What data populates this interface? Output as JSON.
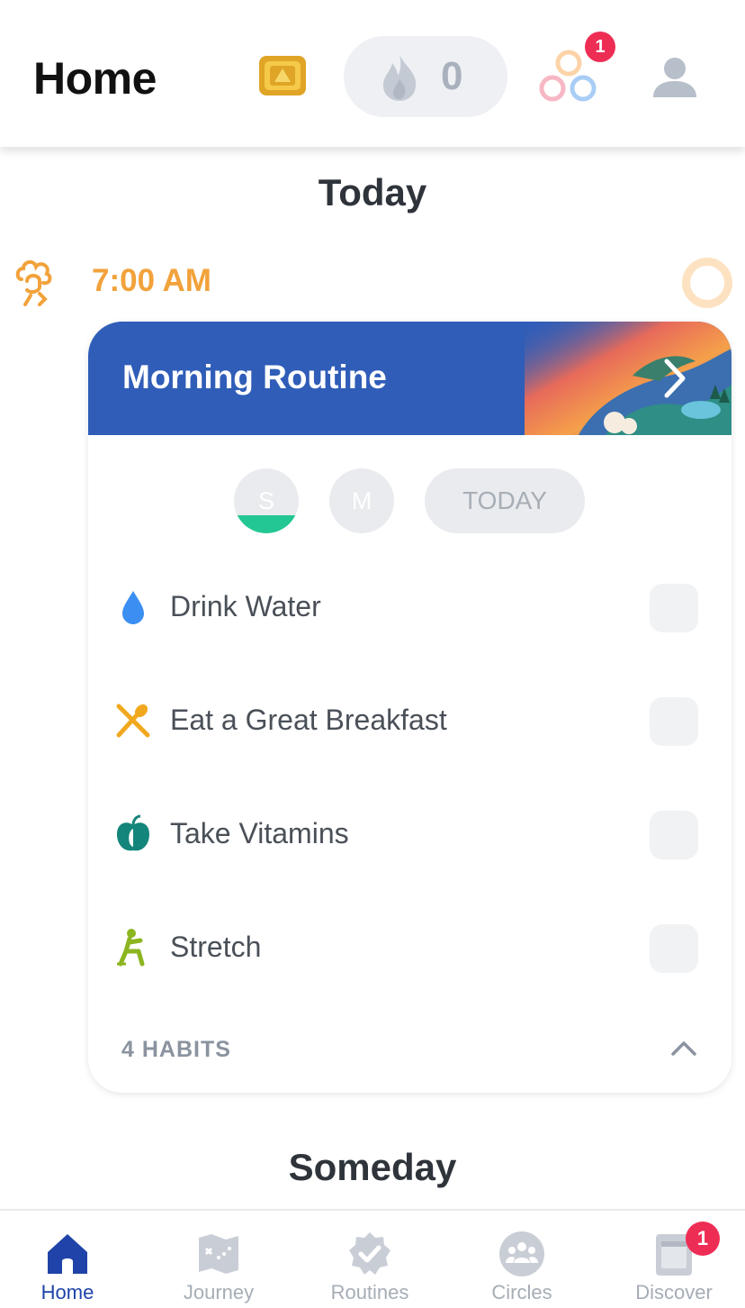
{
  "header": {
    "title": "Home",
    "streak_count": "0",
    "circles_badge": "1"
  },
  "today": {
    "section_title": "Today",
    "time": "7:00 AM",
    "routine": {
      "title": "Morning Routine",
      "days": [
        "S",
        "M",
        "TODAY"
      ],
      "habits": [
        {
          "label": "Drink Water",
          "icon": "water-drop-icon",
          "color": "#3b8ff2"
        },
        {
          "label": "Eat a Great Breakfast",
          "icon": "spoon-fork-icon",
          "color": "#f2a81e"
        },
        {
          "label": "Take Vitamins",
          "icon": "apple-icon",
          "color": "#14857a"
        },
        {
          "label": "Stretch",
          "icon": "stretch-icon",
          "color": "#8cb51f"
        }
      ],
      "habit_count": "4 HABITS"
    }
  },
  "someday": {
    "section_title": "Someday"
  },
  "tabbar": {
    "tabs": [
      {
        "label": "Home",
        "icon": "home-icon"
      },
      {
        "label": "Journey",
        "icon": "map-icon"
      },
      {
        "label": "Routines",
        "icon": "badge-check-icon"
      },
      {
        "label": "Circles",
        "icon": "group-icon"
      },
      {
        "label": "Discover",
        "icon": "book-icon"
      }
    ],
    "discover_badge": "1"
  },
  "colors": {
    "accent": "#2f5db8",
    "active_tab": "#1f43a8",
    "time": "#f2a23b",
    "badge": "#ee2d55",
    "progress": "#23c793"
  }
}
